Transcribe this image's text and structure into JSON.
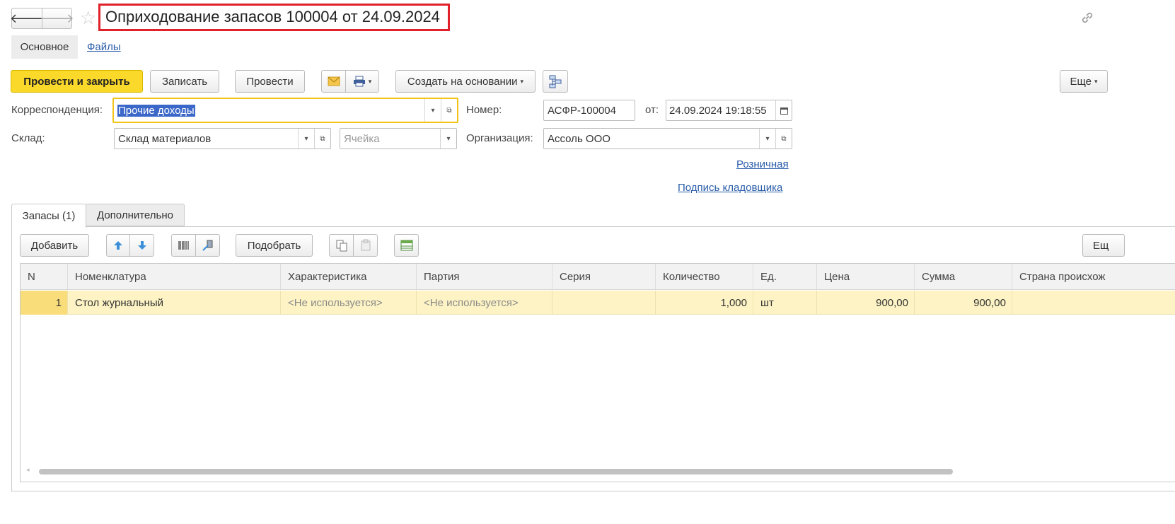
{
  "window": {
    "title": "Оприходование запасов 100004 от 24.09.2024"
  },
  "nav": {
    "back_glyph": "🡐",
    "forward_glyph": "🡒"
  },
  "tabs_top": [
    {
      "label": "Основное",
      "active": true
    },
    {
      "label": "Файлы",
      "active": false
    }
  ],
  "toolbar": {
    "post_close": "Провести и закрыть",
    "save": "Записать",
    "post": "Провести",
    "create_based": "Создать на основании",
    "more": "Еще"
  },
  "form": {
    "correspondence_label": "Корреспонденция:",
    "correspondence_value": "Прочие доходы",
    "number_label": "Номер:",
    "number_value": "АСФР-100004",
    "date_label": "от:",
    "date_value": "24.09.2024 19:18:55",
    "warehouse_label": "Склад:",
    "warehouse_value": "Склад материалов",
    "cell_placeholder": "Ячейка",
    "organization_label": "Организация:",
    "organization_value": "Ассоль ООО",
    "retail_link": "Розничная",
    "signature_link": "Подпись кладовщика"
  },
  "section_tabs": [
    {
      "label": "Запасы (1)",
      "active": true
    },
    {
      "label": "Дополнительно",
      "active": false
    }
  ],
  "table_toolbar": {
    "add": "Добавить",
    "pick": "Подобрать",
    "more": "Ещ"
  },
  "table": {
    "columns": [
      "N",
      "Номенклатура",
      "Характеристика",
      "Партия",
      "Серия",
      "Количество",
      "Ед.",
      "Цена",
      "Сумма",
      "Страна происхож"
    ],
    "rows": [
      {
        "n": "1",
        "nomenclature": "Стол журнальный",
        "characteristic": "<Не используется>",
        "batch": "<Не используется>",
        "series": "",
        "quantity": "1,000",
        "unit": "шт",
        "price": "900,00",
        "sum": "900,00",
        "country": ""
      }
    ]
  },
  "colors": {
    "primary_button": "#fbd92a",
    "highlight_frame": "#e0202a",
    "focus_border": "#f2c318",
    "selection": "#3b67c9",
    "selected_row": "#fdf3c4"
  }
}
